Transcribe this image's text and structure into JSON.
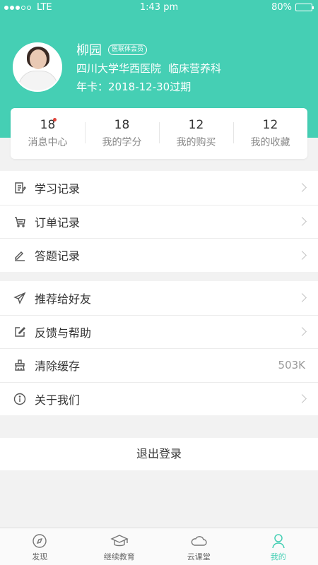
{
  "status_bar": {
    "carrier": "LTE",
    "time": "1:43 pm",
    "battery": "80%",
    "battery_level": 0.8
  },
  "profile": {
    "name": "柳园",
    "badge": "医联体会员",
    "hospital": "四川大学华西医院",
    "department": "临床营养科",
    "card_label": "年卡：",
    "card_expiry": "2018-12-30过期"
  },
  "stats": [
    {
      "value": "18",
      "label": "消息中心"
    },
    {
      "value": "18",
      "label": "我的学分"
    },
    {
      "value": "12",
      "label": "我的购买"
    },
    {
      "value": "12",
      "label": "我的收藏"
    }
  ],
  "menu_group1": [
    {
      "label": "学习记录",
      "icon": "study-record-icon"
    },
    {
      "label": "订单记录",
      "icon": "order-record-icon"
    },
    {
      "label": "答题记录",
      "icon": "answer-record-icon"
    }
  ],
  "menu_group2": [
    {
      "label": "推荐给好友",
      "icon": "send-icon"
    },
    {
      "label": "反馈与帮助",
      "icon": "feedback-icon"
    },
    {
      "label": "清除缓存",
      "icon": "broom-icon",
      "value": "503K"
    },
    {
      "label": "关于我们",
      "icon": "info-icon"
    }
  ],
  "logout_label": "退出登录",
  "tabs": [
    {
      "label": "发现",
      "icon": "compass-icon"
    },
    {
      "label": "继续教育",
      "icon": "graduation-cap-icon"
    },
    {
      "label": "云课堂",
      "icon": "cloud-icon"
    },
    {
      "label": "我的",
      "icon": "person-icon",
      "active": true
    }
  ],
  "colors": {
    "accent": "#45cfb4",
    "notification": "#e0443b"
  }
}
